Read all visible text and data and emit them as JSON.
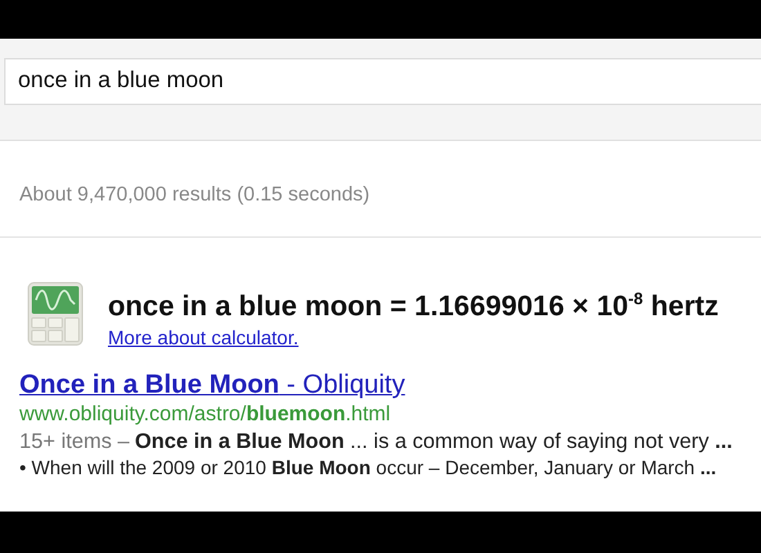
{
  "search": {
    "value": "once in a blue moon"
  },
  "result_stats": "About 9,470,000 results (0.15 seconds)",
  "calculator": {
    "equation": "once in a blue moon = 1.16699016 × 10$^{-8}$ hertz",
    "link": "More about calculator."
  },
  "results": [
    {
      "title": "**Once in a Blue Moon** - Obliquity",
      "url": "www.obliquity.com/astro/**bluemoon**.html",
      "snippet_meta": "15+ items –",
      "snippet": "**Once in a Blue Moon** ... is a common way of saying not very **...**",
      "bullets": [
        "• When will the 2009 or 2010 **Blue Moon** occur – December, January or March **...**"
      ]
    }
  ]
}
